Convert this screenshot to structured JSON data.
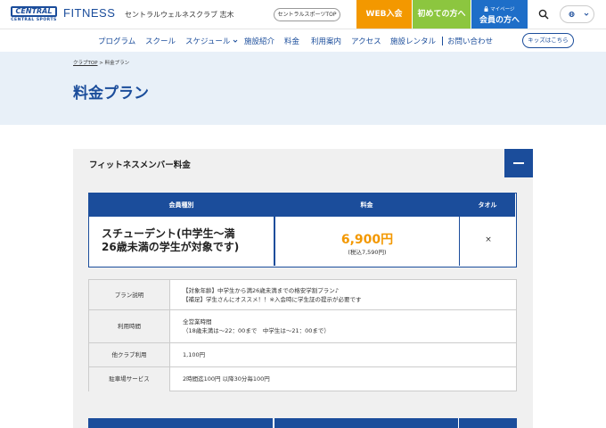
{
  "header": {
    "logo_main": "CENTRAL",
    "logo_sub": "CENTRAL SPORTS",
    "fitness": "FITNESS",
    "club_name": "セントラルウェルネスクラブ 志木",
    "top_link": "セントラルスポーツTOP",
    "web_join": "WEB入会",
    "first_time": "初めての方へ",
    "mypage": "マイページ",
    "member": "会員の方へ",
    "lang_icon": "globe-icon"
  },
  "nav": {
    "items": [
      "プログラム",
      "スクール",
      "スケジュール",
      "施設紹介",
      "料金",
      "利用案内",
      "アクセス",
      "施設レンタル",
      "お問い合わせ"
    ],
    "kids": "キッズはこちら"
  },
  "breadcrumb": {
    "home": "クラブTOP",
    "separator": ">",
    "current": "料金プラン"
  },
  "page_title": "料金プラン",
  "panel": {
    "title": "フィットネスメンバー料金",
    "price_table": {
      "headers": [
        "会員種別",
        "料金",
        "タオル"
      ],
      "member_type": "スチューデント(中学生〜満26歳未満の学生が対象です)",
      "member_type_line1": "スチューデント(中学生〜満",
      "member_type_line2": "26歳未満の学生が対象です)",
      "price": "6,900円",
      "price_tax": "(税込7,590円)",
      "towel": "×"
    },
    "info": [
      {
        "label": "プラン説明",
        "lines": [
          "【対象年齢】中学生から満26歳未満までの格安学割プラン♪",
          "【補足】学生さんにオススメ！！※入会時に学生証の提示が必要です"
        ]
      },
      {
        "label": "利用時間",
        "lines": [
          "全営業時間",
          "（18歳未満は〜22：00まで　中学生は〜21：00まで）"
        ]
      },
      {
        "label": "他クラブ利用",
        "lines": [
          "1,100円"
        ]
      },
      {
        "label": "駐車場サービス",
        "lines": [
          "2時間迄100円 以降30分毎100円"
        ]
      }
    ]
  },
  "colors": {
    "brand": "#1b4d9b",
    "orange": "#f39800",
    "green": "#8cc63f",
    "blue": "#1e6ec8"
  }
}
